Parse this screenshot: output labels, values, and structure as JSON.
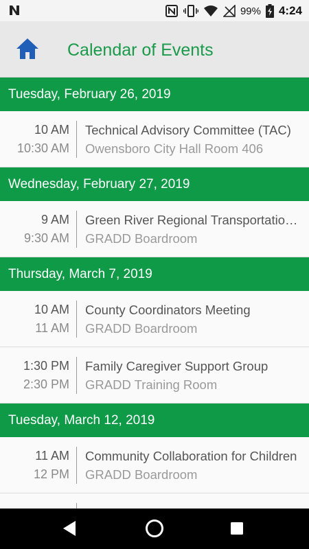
{
  "status_bar": {
    "notification_icon": "n-logo-icon",
    "nfc_icon": "nfc-icon",
    "vibrate_icon": "vibrate-icon",
    "wifi_icon": "wifi-icon",
    "signal_icon": "no-signal-icon",
    "battery_percent": "99%",
    "battery_icon": "battery-charging-icon",
    "time": "4:24"
  },
  "app_bar": {
    "home_icon": "home-icon",
    "title": "Calendar of Events",
    "accent_color": "#0f9a47"
  },
  "groups": [
    {
      "date": "Tuesday, February 26, 2019",
      "events": [
        {
          "start": "10 AM",
          "end": "10:30 AM",
          "title": "Technical Advisory Committee (TAC)",
          "location": "Owensboro City Hall Room 406"
        }
      ]
    },
    {
      "date": "Wednesday, February 27, 2019",
      "events": [
        {
          "start": "9 AM",
          "end": "9:30 AM",
          "title": "Green River Regional Transportation Committee",
          "location": "GRADD Boardroom"
        }
      ]
    },
    {
      "date": "Thursday, March 7, 2019",
      "events": [
        {
          "start": "10 AM",
          "end": "11 AM",
          "title": "County Coordinators Meeting",
          "location": "GRADD Boardroom"
        },
        {
          "start": "1:30 PM",
          "end": "2:30 PM",
          "title": "Family Caregiver Support Group",
          "location": "GRADD Training Room"
        }
      ]
    },
    {
      "date": "Tuesday, March 12, 2019",
      "events": [
        {
          "start": "11 AM",
          "end": "12 PM",
          "title": "Community Collaboration for Children",
          "location": "GRADD Boardroom"
        }
      ]
    }
  ],
  "nav_bar": {
    "back_icon": "back-triangle-icon",
    "home_icon": "home-circle-icon",
    "recents_icon": "recents-square-icon"
  }
}
